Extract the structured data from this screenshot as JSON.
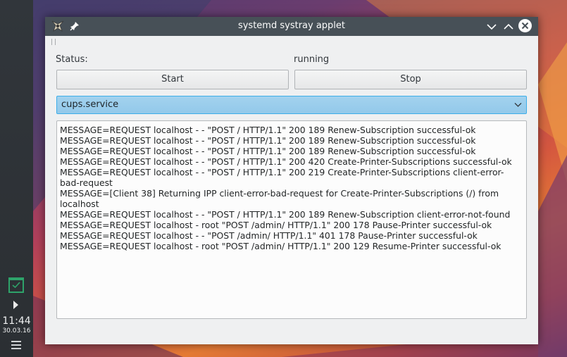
{
  "desktop": {
    "clock_time": "11:44",
    "clock_date": "30.03.16",
    "tray_icon": "systemd-check-icon"
  },
  "window": {
    "title": "systemd systray applet",
    "app_icon": "systemd-app-icon",
    "buttons": {
      "pin": "pin-icon",
      "minimize": "chevron-down-icon",
      "maximize": "chevron-up-icon",
      "close": "close-icon"
    }
  },
  "status": {
    "label": "Status:",
    "value": "running"
  },
  "actions": {
    "start_label": "Start",
    "stop_label": "Stop"
  },
  "service_select": {
    "selected": "cups.service"
  },
  "log": {
    "lines": [
      "MESSAGE=REQUEST localhost - - \"POST / HTTP/1.1\" 200 189 Renew-Subscription successful-ok",
      "MESSAGE=REQUEST localhost - - \"POST / HTTP/1.1\" 200 189 Renew-Subscription successful-ok",
      "MESSAGE=REQUEST localhost - - \"POST / HTTP/1.1\" 200 189 Renew-Subscription successful-ok",
      "MESSAGE=REQUEST localhost - - \"POST / HTTP/1.1\" 200 420 Create-Printer-Subscriptions successful-ok",
      "MESSAGE=REQUEST localhost - - \"POST / HTTP/1.1\" 200 219 Create-Printer-Subscriptions client-error-bad-request",
      "MESSAGE=[Client 38] Returning IPP client-error-bad-request for Create-Printer-Subscriptions (/) from localhost",
      "MESSAGE=REQUEST localhost - - \"POST / HTTP/1.1\" 200 189 Renew-Subscription client-error-not-found",
      "MESSAGE=REQUEST localhost - root \"POST /admin/ HTTP/1.1\" 200 178 Pause-Printer successful-ok",
      "MESSAGE=REQUEST localhost - - \"POST /admin/ HTTP/1.1\" 401 178 Pause-Printer successful-ok",
      "MESSAGE=REQUEST localhost - root \"POST /admin/ HTTP/1.1\" 200 129 Resume-Printer successful-ok"
    ]
  },
  "colors": {
    "accent": "#3daee9",
    "titlebar": "#475057",
    "panel": "#31363b",
    "tray_green": "#2ea36a"
  }
}
